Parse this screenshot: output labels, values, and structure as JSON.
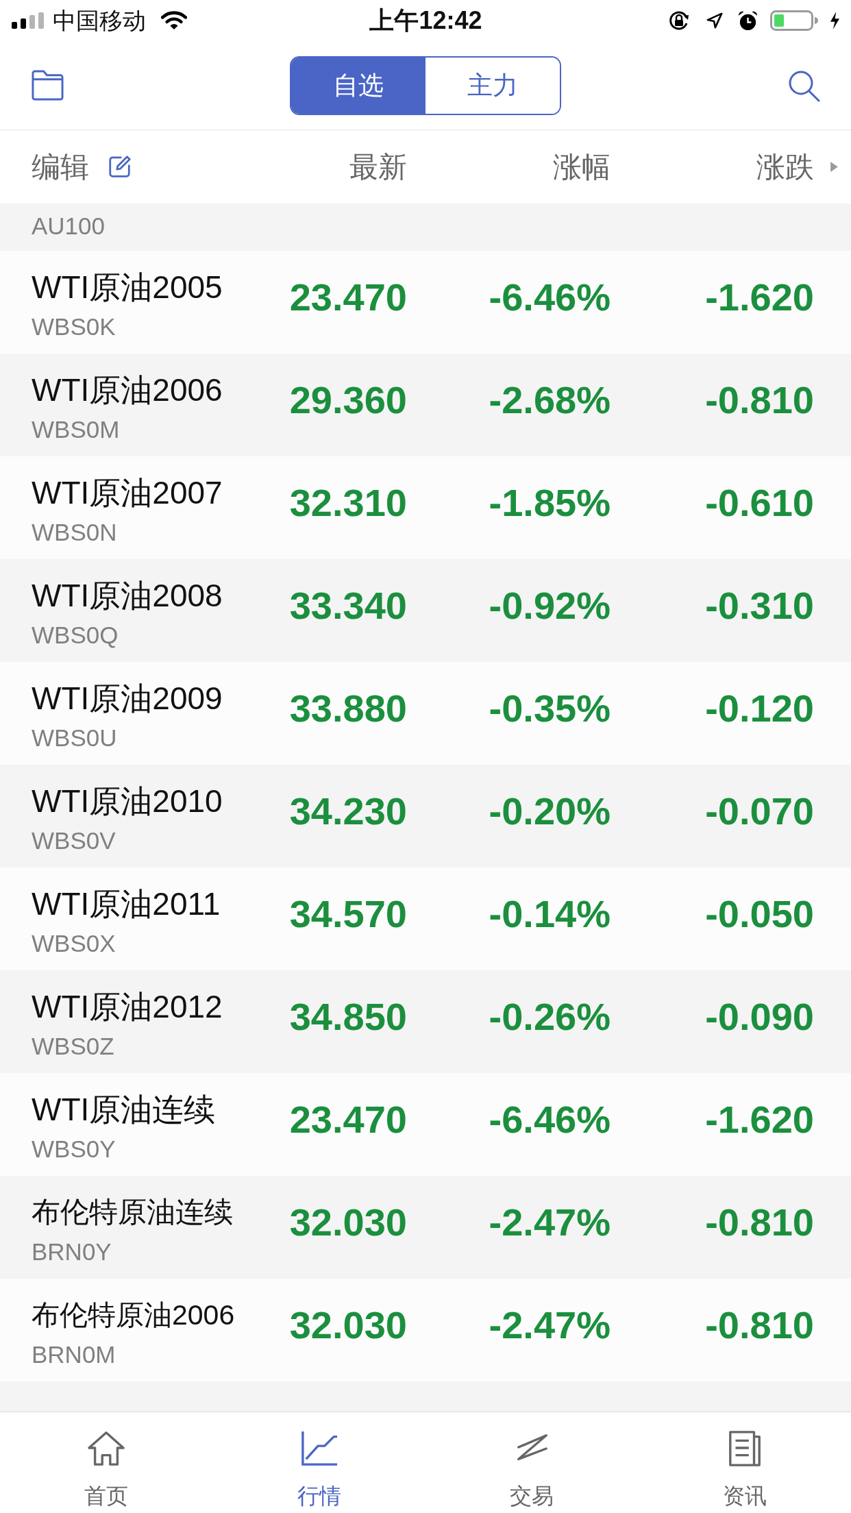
{
  "status_bar": {
    "carrier": "中国移动",
    "time": "上午12:42"
  },
  "nav": {
    "tabs": [
      {
        "label": "自选",
        "selected": true
      },
      {
        "label": "主力",
        "selected": false
      }
    ]
  },
  "list_header": {
    "edit_label": "编辑",
    "columns": [
      "最新",
      "涨幅",
      "涨跌"
    ]
  },
  "rows": [
    {
      "kind": "clipped",
      "code": "AU100"
    },
    {
      "kind": "full",
      "name": "WTI原油2005",
      "code": "WBS0K",
      "last": "23.470",
      "change_percent": "-6.46%",
      "change": "-1.620",
      "falling": true
    },
    {
      "kind": "full",
      "name": "WTI原油2006",
      "code": "WBS0M",
      "last": "29.360",
      "change_percent": "-2.68%",
      "change": "-0.810",
      "falling": true
    },
    {
      "kind": "full",
      "name": "WTI原油2007",
      "code": "WBS0N",
      "last": "32.310",
      "change_percent": "-1.85%",
      "change": "-0.610",
      "falling": true
    },
    {
      "kind": "full",
      "name": "WTI原油2008",
      "code": "WBS0Q",
      "last": "33.340",
      "change_percent": "-0.92%",
      "change": "-0.310",
      "falling": true
    },
    {
      "kind": "full",
      "name": "WTI原油2009",
      "code": "WBS0U",
      "last": "33.880",
      "change_percent": "-0.35%",
      "change": "-0.120",
      "falling": true
    },
    {
      "kind": "full",
      "name": "WTI原油2010",
      "code": "WBS0V",
      "last": "34.230",
      "change_percent": "-0.20%",
      "change": "-0.070",
      "falling": true
    },
    {
      "kind": "full",
      "name": "WTI原油2011",
      "code": "WBS0X",
      "last": "34.570",
      "change_percent": "-0.14%",
      "change": "-0.050",
      "falling": true
    },
    {
      "kind": "full",
      "name": "WTI原油2012",
      "code": "WBS0Z",
      "last": "34.850",
      "change_percent": "-0.26%",
      "change": "-0.090",
      "falling": true
    },
    {
      "kind": "full",
      "name": "WTI原油连续",
      "code": "WBS0Y",
      "last": "23.470",
      "change_percent": "-6.46%",
      "change": "-1.620",
      "falling": true
    },
    {
      "kind": "full",
      "name": "布伦特原油连续",
      "code": "BRN0Y",
      "last": "32.030",
      "change_percent": "-2.47%",
      "change": "-0.810",
      "falling": true
    },
    {
      "kind": "full",
      "name": "布伦特原油2006",
      "code": "BRN0M",
      "last": "32.030",
      "change_percent": "-2.47%",
      "change": "-0.810",
      "falling": true
    }
  ],
  "tab_bar": {
    "items": [
      {
        "label": "首页",
        "selected": false
      },
      {
        "label": "行情",
        "selected": true
      },
      {
        "label": "交易",
        "selected": false
      },
      {
        "label": "资讯",
        "selected": false
      }
    ]
  }
}
